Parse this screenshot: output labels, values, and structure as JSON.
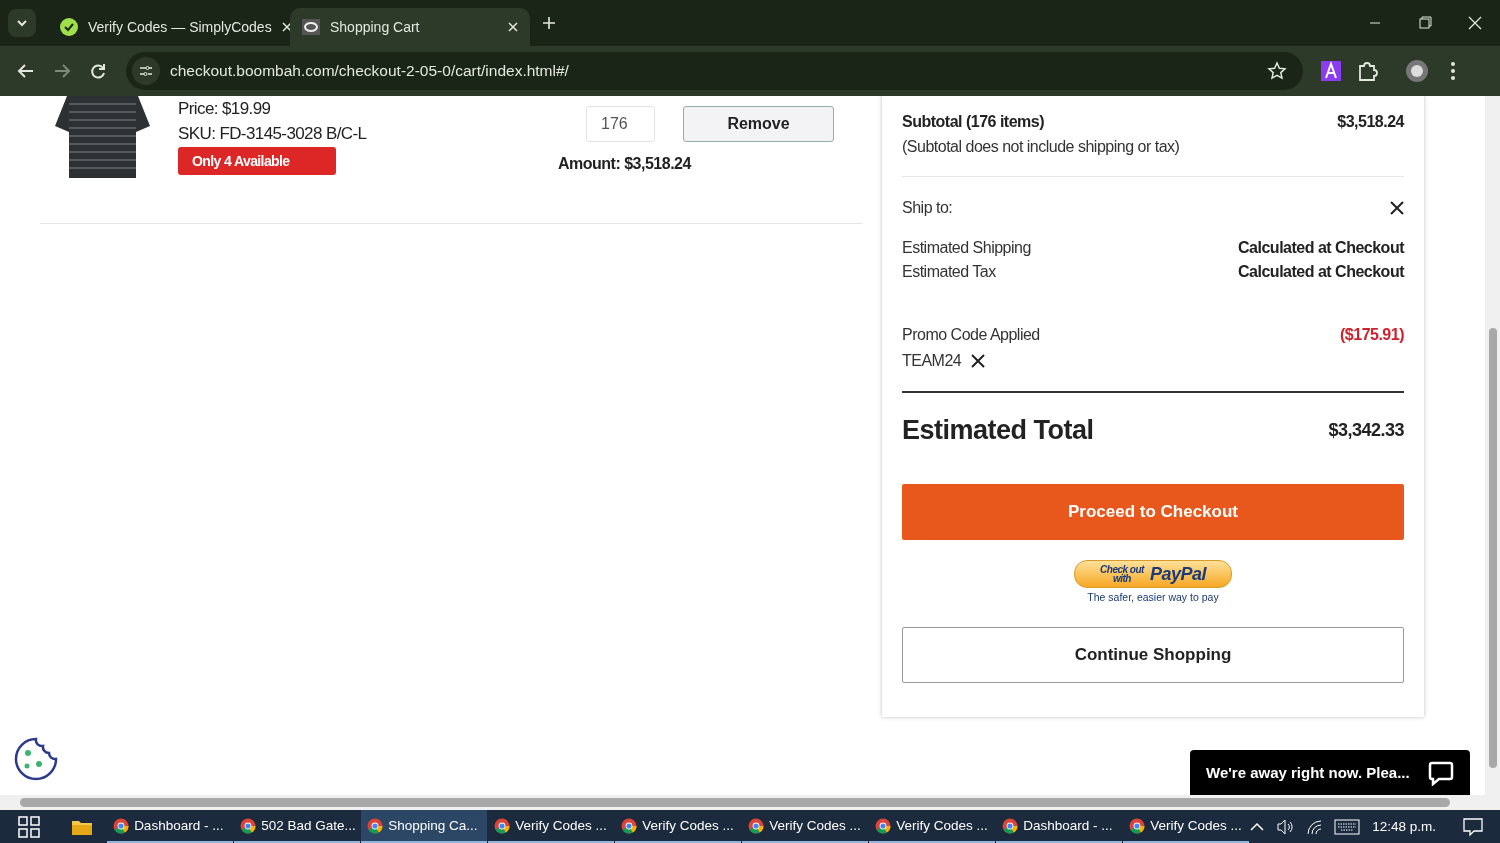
{
  "browser": {
    "tabs": [
      {
        "title": "Verify Codes — SimplyCodes",
        "selected": false
      },
      {
        "title": "Shopping Cart",
        "selected": true
      }
    ],
    "url": "checkout.boombah.com/checkout-2-05-0/cart/index.html#/"
  },
  "cart_item": {
    "price": "Price: $19.99",
    "sku": "SKU: FD-3145-3028 B/C-L",
    "stock_badge": "Only 4 Available",
    "quantity": "176",
    "remove_button": "Remove",
    "amount": "Amount: $3,518.24"
  },
  "summary": {
    "subtotal_label": "Subtotal (176 items)",
    "subtotal_value": "$3,518.24",
    "subtotal_note": "(Subtotal does not include shipping or tax)",
    "ship_to_label": "Ship to:",
    "lines": [
      {
        "label": "Estimated Shipping",
        "value": "Calculated at Checkout"
      },
      {
        "label": "Estimated Tax",
        "value": "Calculated at Checkout"
      }
    ],
    "promo": {
      "label": "Promo Code Applied",
      "value": "($175.91)",
      "code": "TEAM24"
    },
    "total_label": "Estimated Total",
    "total_value": "$3,342.33",
    "checkout_button": "Proceed to Checkout",
    "paypal": {
      "line1": "Check out",
      "line2": "with",
      "brand": "PayPal",
      "tagline": "The safer, easier way to pay"
    },
    "continue_button": "Continue Shopping"
  },
  "chat": {
    "text": "We're away right now. Plea..."
  },
  "taskbar": {
    "items": [
      {
        "label": "Dashboard - ...",
        "selected": false
      },
      {
        "label": "502 Bad Gate...",
        "selected": false
      },
      {
        "label": "Shopping Ca...",
        "selected": true
      },
      {
        "label": "Verify Codes ...",
        "selected": false
      },
      {
        "label": "Verify Codes ...",
        "selected": false
      },
      {
        "label": "Verify Codes ...",
        "selected": false
      },
      {
        "label": "Verify Codes ...",
        "selected": false
      },
      {
        "label": "Dashboard - ...",
        "selected": false
      },
      {
        "label": "Verify Codes ...",
        "selected": false
      }
    ],
    "clock": "12:48 p.m."
  }
}
